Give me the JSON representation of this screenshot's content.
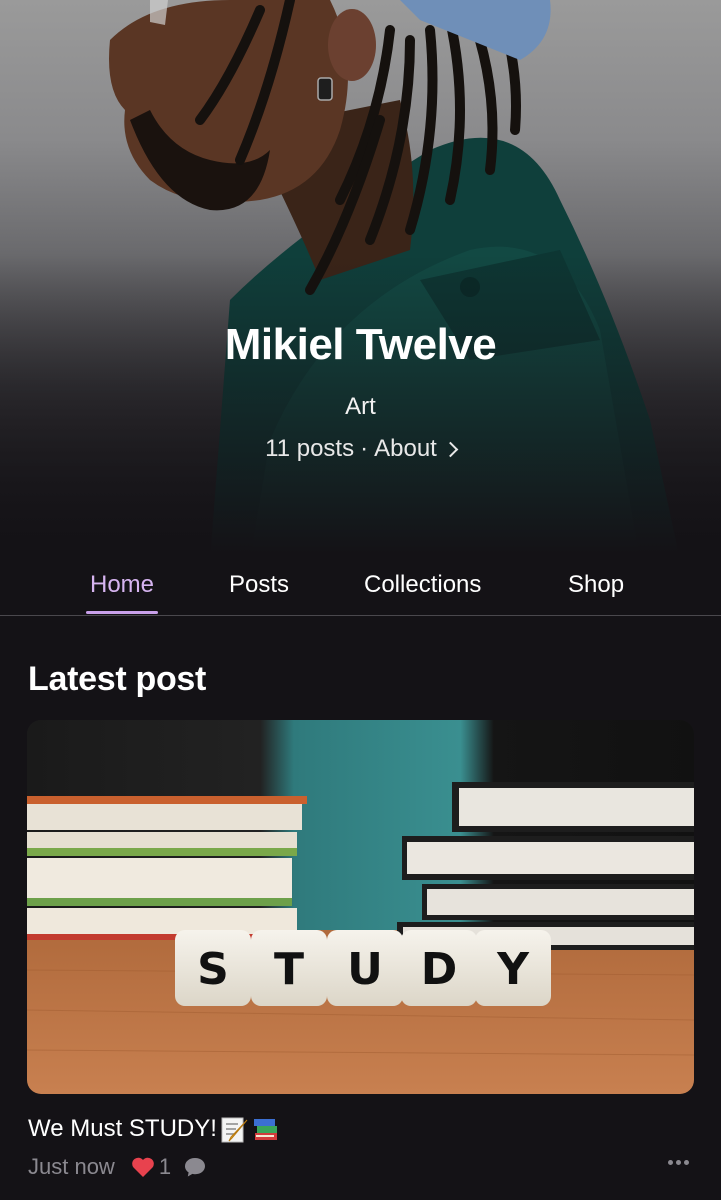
{
  "creator": {
    "name": "Mikiel Twelve",
    "category": "Art",
    "posts_count": "11 posts",
    "separator": "·",
    "about_label": "About"
  },
  "tabs": [
    {
      "label": "Home",
      "active": true
    },
    {
      "label": "Posts",
      "active": false
    },
    {
      "label": "Collections",
      "active": false
    },
    {
      "label": "Shop",
      "active": false
    }
  ],
  "latest": {
    "section_title": "Latest post",
    "post": {
      "title": "We Must STUDY!",
      "image_dice_letters": [
        "S",
        "T",
        "U",
        "D",
        "Y"
      ],
      "time": "Just now",
      "likes": "1"
    }
  },
  "colors": {
    "background": "#141216",
    "accent_tab": "#d6b4f0",
    "heart": "#e8424e",
    "muted_text": "#8b8990"
  },
  "icons": [
    "chevron-right-icon",
    "heart-icon",
    "comment-icon",
    "more-options-icon",
    "memo-emoji-icon",
    "books-emoji-icon"
  ]
}
